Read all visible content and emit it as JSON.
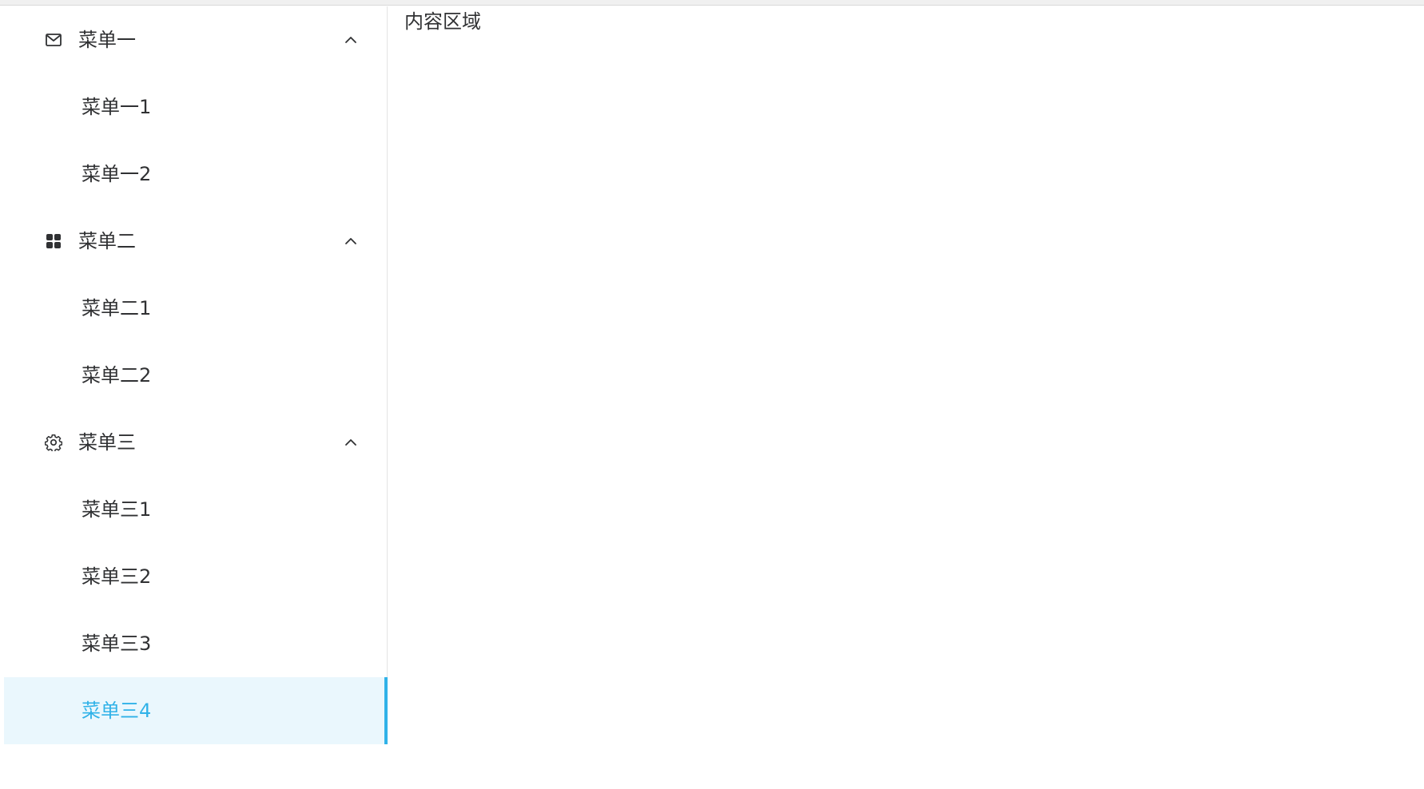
{
  "sidebar": {
    "groups": [
      {
        "title": "菜单一",
        "icon": "mail-icon",
        "expanded": true,
        "items": [
          {
            "label": "菜单一1"
          },
          {
            "label": "菜单一2"
          }
        ]
      },
      {
        "title": "菜单二",
        "icon": "grid-icon",
        "expanded": true,
        "items": [
          {
            "label": "菜单二1"
          },
          {
            "label": "菜单二2"
          }
        ]
      },
      {
        "title": "菜单三",
        "icon": "gear-icon",
        "expanded": true,
        "items": [
          {
            "label": "菜单三1"
          },
          {
            "label": "菜单三2"
          },
          {
            "label": "菜单三3"
          },
          {
            "label": "菜单三4",
            "active": true
          }
        ]
      }
    ]
  },
  "content": {
    "text": "内容区域"
  },
  "colors": {
    "active_text": "#30b2e8",
    "active_background": "#eaf7fd",
    "text": "#303133"
  }
}
